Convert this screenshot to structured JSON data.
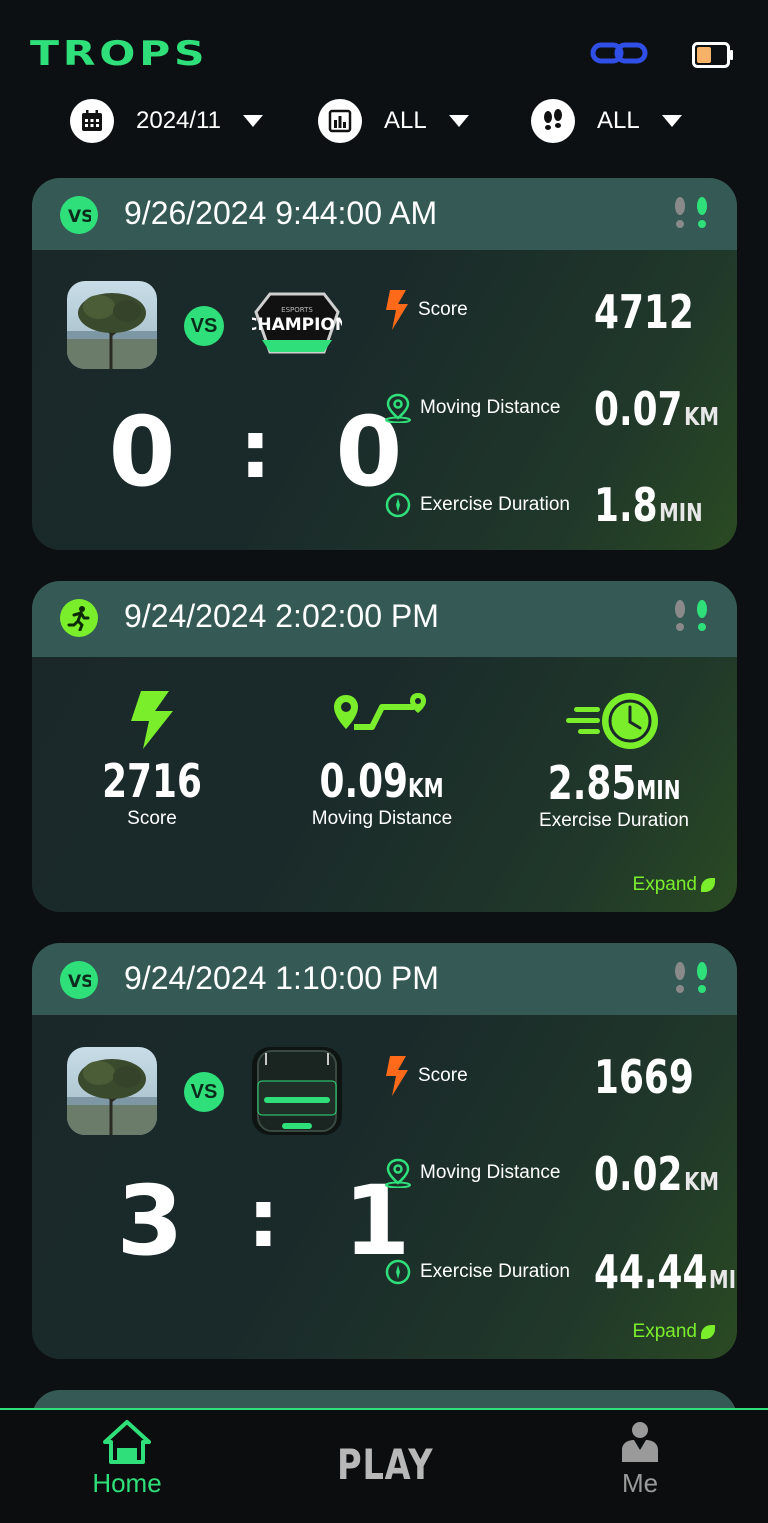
{
  "app": {
    "title": "TROPS"
  },
  "filters": {
    "month": "2024/11",
    "type": "ALL",
    "mode": "ALL"
  },
  "cards": [
    {
      "kind": "vs",
      "datetime": "9/26/2024 9:44:00 AM",
      "vs_label": "VS",
      "opponent": "CHAMPION LEAGUE",
      "score_left": "0",
      "score_right": "0",
      "score_sep": ":",
      "labels": {
        "score": "Score",
        "distance": "Moving Distance",
        "duration": "Exercise Duration"
      },
      "score": "4712",
      "distance": "0.07",
      "distance_unit": "KM",
      "duration": "1.8",
      "duration_unit": "MIN"
    },
    {
      "kind": "run",
      "datetime": "9/24/2024 2:02:00 PM",
      "labels": {
        "score": "Score",
        "distance": "Moving Distance",
        "duration": "Exercise Duration"
      },
      "score": "2716",
      "distance": "0.09",
      "distance_unit": "KM",
      "duration": "2.85",
      "duration_unit": "MIN",
      "expand": "Expand"
    },
    {
      "kind": "vs",
      "datetime": "9/24/2024 1:10:00 PM",
      "vs_label": "VS",
      "score_left": "3",
      "score_right": "1",
      "score_sep": ":",
      "labels": {
        "score": "Score",
        "distance": "Moving Distance",
        "duration": "Exercise Duration"
      },
      "score": "1669",
      "distance": "0.02",
      "distance_unit": "KM",
      "duration": "44.44",
      "duration_unit": "MIN",
      "expand": "Expand"
    }
  ],
  "nav": {
    "home": "Home",
    "play": "PLAY",
    "me": "Me"
  },
  "colors": {
    "accent": "#2fe07a",
    "lime": "#7bee2c",
    "card_head": "#355a56",
    "orange": "#ff6a1a"
  }
}
